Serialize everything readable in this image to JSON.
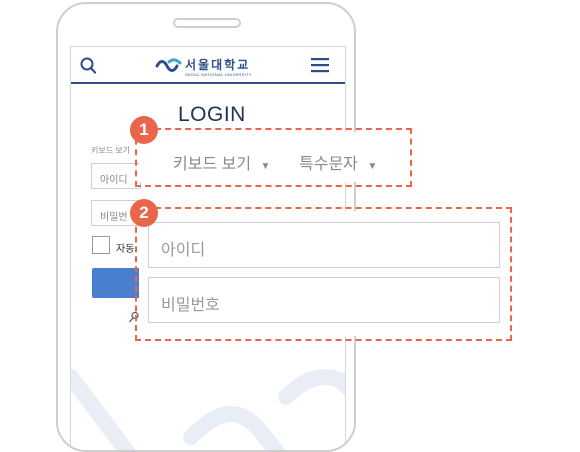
{
  "mobile_page": {
    "logo_text": "서울대학교",
    "logo_subtext": "SEOUL NATIONAL UNIVERSITY",
    "login_title": "LOGIN",
    "keyboard_label_small": "키보드 보기",
    "id_placeholder_small": "아이디",
    "password_placeholder_small": "비밀번",
    "auto_label_small": "자동"
  },
  "callout_1": {
    "badge": "1",
    "keyboard_label": "키보드 보기",
    "special_chars_label": "특수문자",
    "caret": "▼"
  },
  "callout_2": {
    "badge": "2",
    "id_placeholder": "아이디",
    "password_placeholder": "비밀번호"
  },
  "colors": {
    "accent": "#e9664a",
    "brand_navy": "#2c4f8c",
    "button_blue": "#4a7fcf"
  },
  "icons": {
    "search": "search-icon",
    "menu": "hamburger-menu-icon",
    "logo": "snu-logo-icon",
    "user": "user-icon"
  }
}
